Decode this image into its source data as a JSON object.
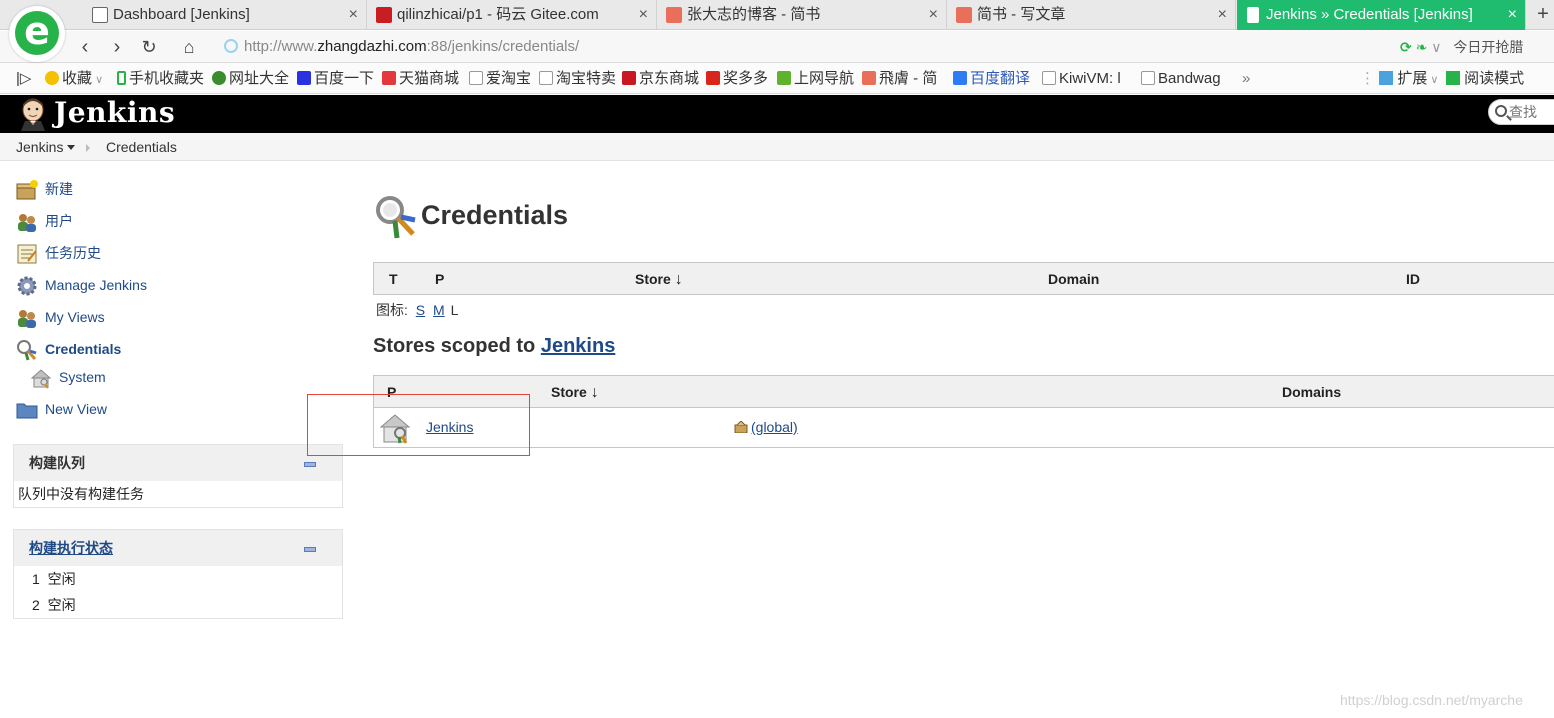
{
  "browser": {
    "tabs": [
      {
        "label": "Dashboard [Jenkins]",
        "close": "×"
      },
      {
        "label": "qilinzhicai/p1 - 码云 Gitee.com",
        "close": "×"
      },
      {
        "label": "张大志的博客 - 简书",
        "close": "×"
      },
      {
        "label": "简书 - 写文章",
        "close": "×"
      },
      {
        "label": "Jenkins » Credentials [Jenkins]",
        "close": "×"
      }
    ],
    "new_tab": "+",
    "url_prefix": "http://www.",
    "url_domain": "zhangdazhi.com",
    "url_suffix": ":88/jenkins/credentials/",
    "addr_right_text": "今日开抢腊",
    "bookmarks": [
      "收藏",
      "手机收藏夹",
      "网址大全",
      "百度一下",
      "天猫商城",
      "爱淘宝",
      "淘宝特卖",
      "京东商城",
      "奖多多",
      "上网导航",
      "飛膚 - 简",
      "百度翻译",
      "KiwiVM: l",
      "Bandwag"
    ],
    "bookmark_more": "»",
    "extensions_label": "扩展",
    "reader_mode_label": "阅读模式"
  },
  "jenkins": {
    "title": "Jenkins",
    "search_placeholder": "查找",
    "breadcrumb": {
      "root": "Jenkins",
      "current": "Credentials"
    }
  },
  "sidebar": {
    "tasks": [
      {
        "label": "新建"
      },
      {
        "label": "用户"
      },
      {
        "label": "任务历史"
      },
      {
        "label": "Manage Jenkins"
      },
      {
        "label": "My Views"
      },
      {
        "label": "Credentials"
      },
      {
        "label": "System"
      },
      {
        "label": "New View"
      }
    ],
    "build_queue": {
      "title": "构建队列",
      "empty_text": "队列中没有构建任务"
    },
    "executors": {
      "title": "构建执行状态",
      "rows": [
        {
          "num": "1",
          "status": "空闲"
        },
        {
          "num": "2",
          "status": "空闲"
        }
      ]
    }
  },
  "main": {
    "title": "Credentials",
    "credentials_table": {
      "headers": {
        "t": "T",
        "p": "P",
        "store": "Store",
        "domain": "Domain",
        "id": "ID"
      },
      "sort_arrow": "↓"
    },
    "icon_size": {
      "label": "图标:",
      "s": "S",
      "m": "M",
      "l": "L"
    },
    "stores_heading_prefix": "Stores scoped to",
    "stores_heading_link": "Jenkins",
    "stores_table": {
      "headers": {
        "p": "P",
        "store": "Store",
        "domains": "Domains"
      },
      "sort_arrow": "↓",
      "rows": [
        {
          "store": "Jenkins",
          "domain": "(global)"
        }
      ]
    }
  },
  "watermark": "https://blog.csdn.net/myarche",
  "colors": {
    "accent_tab": "#1fbb6f",
    "header_bg": "#000000",
    "link": "#204a87",
    "highlight_box": "#e8443b"
  }
}
